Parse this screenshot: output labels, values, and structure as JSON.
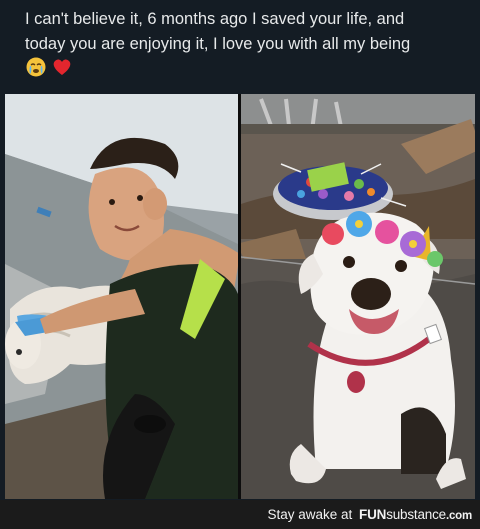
{
  "post": {
    "caption_line1": "I can't believe it, 6 months ago I saved your life, and",
    "caption_line2": "today you are enjoying it, I love you with all my being",
    "emojis": [
      "crying-face-icon",
      "red-heart-icon"
    ]
  },
  "footer": {
    "tagline": "Stay awake at",
    "brand_bold": "FUN",
    "brand_rest": "substance",
    "brand_domain": ".com"
  },
  "colors": {
    "post_background": "#141c24",
    "caption_text": "#e7e9ea",
    "footer_background": "#1b1b1b",
    "footer_text": "#f2f2f2"
  }
}
